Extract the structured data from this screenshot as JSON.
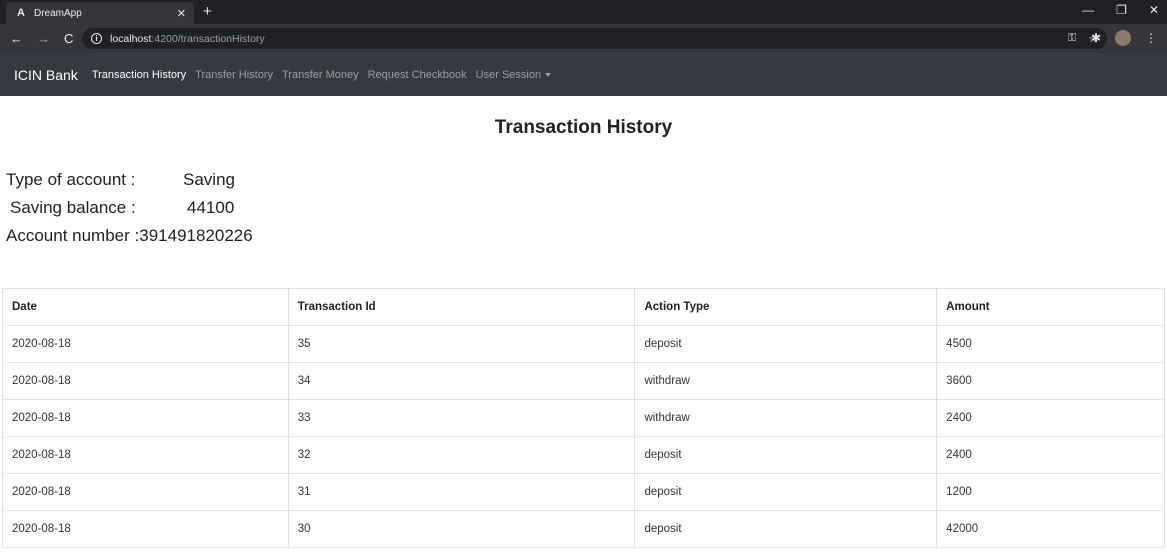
{
  "browser": {
    "tab_title": "DreamApp",
    "tab_favicon": "A",
    "url_host": "localhost",
    "url_path": ":4200/transactionHistory"
  },
  "navbar": {
    "brand": "ICIN Bank",
    "links": [
      {
        "label": "Transaction History"
      },
      {
        "label": "Transfer History"
      },
      {
        "label": "Transfer Money"
      },
      {
        "label": "Request Checkbook"
      },
      {
        "label": "User Session"
      }
    ]
  },
  "page": {
    "title": "Transaction History",
    "account_type_label": "Type of account :",
    "account_type_value": "Saving",
    "balance_label": "Saving balance :",
    "balance_value": "44100",
    "account_number_label": "Account number :",
    "account_number_value": "391491820226"
  },
  "table": {
    "headers": [
      "Date",
      "Transaction Id",
      "Action Type",
      "Amount"
    ],
    "rows": [
      [
        "2020-08-18",
        "35",
        "deposit",
        "4500"
      ],
      [
        "2020-08-18",
        "34",
        "withdraw",
        "3600"
      ],
      [
        "2020-08-18",
        "33",
        "withdraw",
        "2400"
      ],
      [
        "2020-08-18",
        "32",
        "deposit",
        "2400"
      ],
      [
        "2020-08-18",
        "31",
        "deposit",
        "1200"
      ],
      [
        "2020-08-18",
        "30",
        "deposit",
        "42000"
      ]
    ]
  }
}
